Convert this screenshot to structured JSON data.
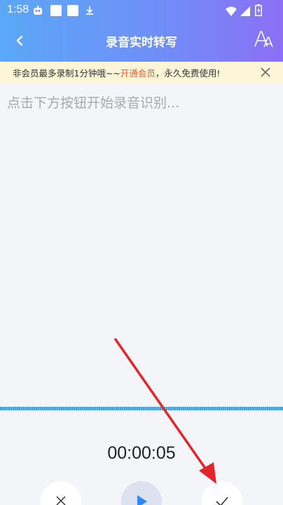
{
  "status_bar": {
    "time": "1:58"
  },
  "nav": {
    "title": "录音实时转写"
  },
  "banner": {
    "prefix": "非会员最多录制1分钟哦~~",
    "link": "开通会员",
    "suffix": "，永久免费使用!"
  },
  "transcript": {
    "placeholder": "点击下方按钮开始录音识别..."
  },
  "recorder": {
    "elapsed": "00:00:05"
  },
  "colors": {
    "header_start": "#5aa8f7",
    "header_end": "#8c6ff5",
    "banner_bg": "#fdf5d8",
    "link": "#f05a2c",
    "wave": "#3e9be0",
    "play": "#2f86f6",
    "annotation_arrow": "#e3242b"
  },
  "icons": {
    "back": "chevron-left-icon",
    "font_size": "font-size-icon",
    "close": "close-icon",
    "cancel": "x-icon",
    "play": "play-icon",
    "confirm": "check-icon"
  }
}
